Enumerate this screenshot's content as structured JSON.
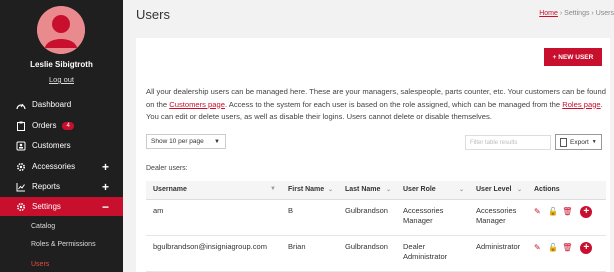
{
  "sidebar": {
    "user_name": "Leslie Sibigtroth",
    "logout": "Log out",
    "items": [
      {
        "label": "Dashboard"
      },
      {
        "label": "Orders",
        "badge": "4"
      },
      {
        "label": "Customers"
      },
      {
        "label": "Accessories"
      },
      {
        "label": "Reports"
      },
      {
        "label": "Settings"
      }
    ],
    "sub_items": [
      {
        "label": "Catalog"
      },
      {
        "label": "Roles & Permissions"
      },
      {
        "label": "Users"
      }
    ]
  },
  "header": {
    "title": "Users",
    "breadcrumb": {
      "home": "Home",
      "sep": "›",
      "settings": "Settings",
      "current": "Users"
    }
  },
  "toolbar": {
    "new_user": "+ NEW USER"
  },
  "description": {
    "part1": "All your dealership users can be managed here. These are your managers, salespeople, parts counter, etc. Your customers can be found on the ",
    "link1": "Customers page",
    "part2": ". Access to the system for each user is based on the role assigned, which can be managed from the ",
    "link2": "Roles page",
    "part3": ". You can edit or delete users, as well as disable their logins. Users cannot delete or disable themselves."
  },
  "controls": {
    "page_size": "Show 10 per page",
    "filter_placeholder": "Filter table results",
    "export": "Export"
  },
  "table": {
    "caption": "Dealer users:",
    "columns": [
      "Username",
      "First Name",
      "Last Name",
      "User Role",
      "User Level",
      "Actions"
    ],
    "rows": [
      {
        "username": "am",
        "first": "B",
        "last": "Gulbrandson",
        "role": "Accessories Manager",
        "level": "Accessories Manager"
      },
      {
        "username": "bgulbrandson@insigniagroup.com",
        "first": "Brian",
        "last": "Gulbrandson",
        "role": "Dealer Administrator",
        "level": "Administrator"
      }
    ]
  },
  "colors": {
    "accent": "#c8102e",
    "sidebar": "#1f1f1f",
    "avatar": "#e88a8e"
  }
}
